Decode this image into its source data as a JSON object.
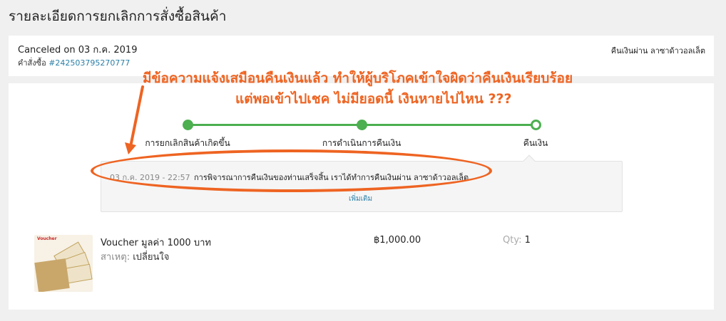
{
  "page": {
    "title": "รายละเอียดการยกเลิกการสั่งซื้อสินค้า"
  },
  "order": {
    "canceled_on": "Canceled on 03 ก.ค. 2019",
    "order_label": "คำสั่งซื้อ",
    "order_number": "#242503795270777",
    "refund_via": "คืนเงินผ่าน ลาซาด้าวอลเล็ต"
  },
  "annotation": {
    "line1": "มีข้อความแจ้งเสมือนคืนเงินแล้ว ทำให้ผู้บริโภคเข้าใจผิดว่าคืนเงินเรียบร้อย",
    "line2": "แต่พอเข้าไปเชค ไม่มียอดนี้ เงินหายไปไหน ???",
    "color": "#ee6422"
  },
  "progress": {
    "steps": [
      {
        "label": "การยกเลิกสินค้าเกิดขึ้น",
        "done": true
      },
      {
        "label": "การดำเนินการคืนเงิน",
        "done": true
      },
      {
        "label": "คืนเงิน",
        "done": false
      }
    ],
    "color": "#4caf50"
  },
  "event": {
    "time": "03 ก.ค. 2019 - 22:57",
    "message": "การพิจารณาการคืนเงินของท่านเสร็จสิ้น เราได้ทำการคืนเงินผ่าน ลาซาด้าวอลเล็ต",
    "see_more": "เพิ่มเติม"
  },
  "item": {
    "name": "Voucher มูลค่า 1000 บาท",
    "reason_label": "สาเหตุ:",
    "reason_value": "เปลี่ยนใจ",
    "price": "฿1,000.00",
    "qty_label": "Qty:",
    "qty_value": "1",
    "thumb_text": "Voucher"
  }
}
